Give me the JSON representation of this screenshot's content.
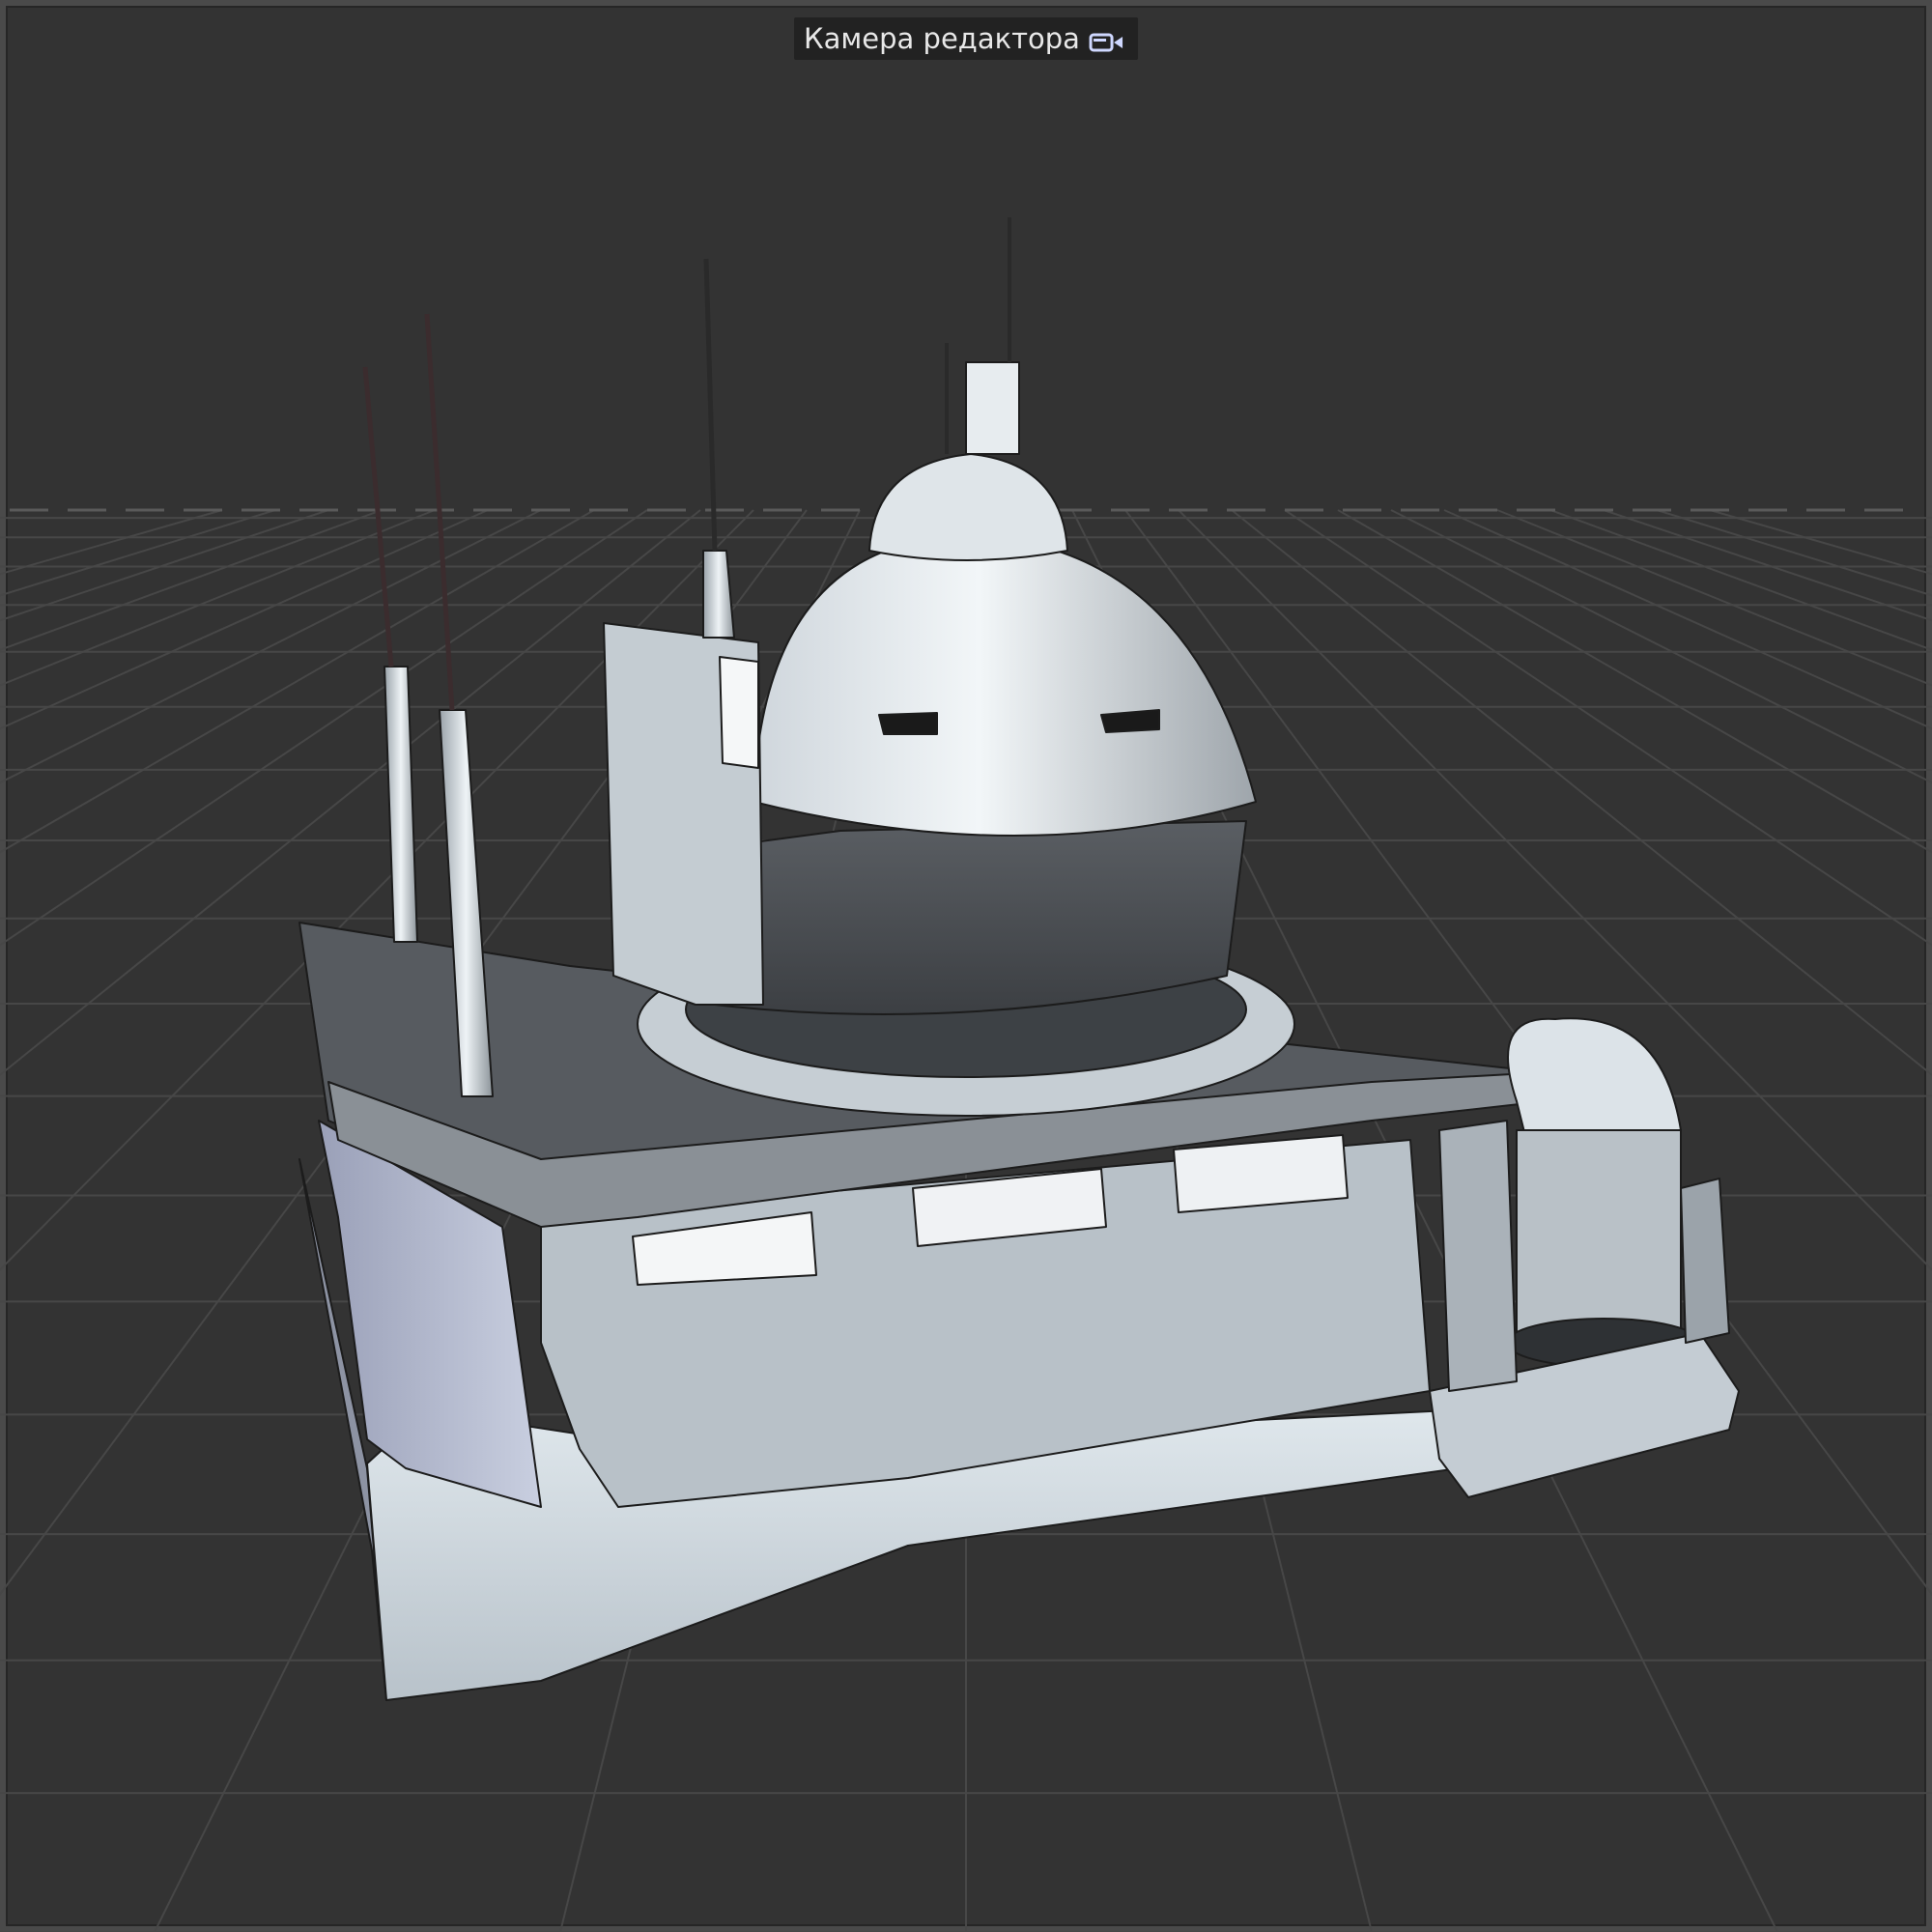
{
  "viewport": {
    "camera_label": "Камера редактора",
    "camera_icon": "camera-icon",
    "background_color": "#333333"
  }
}
